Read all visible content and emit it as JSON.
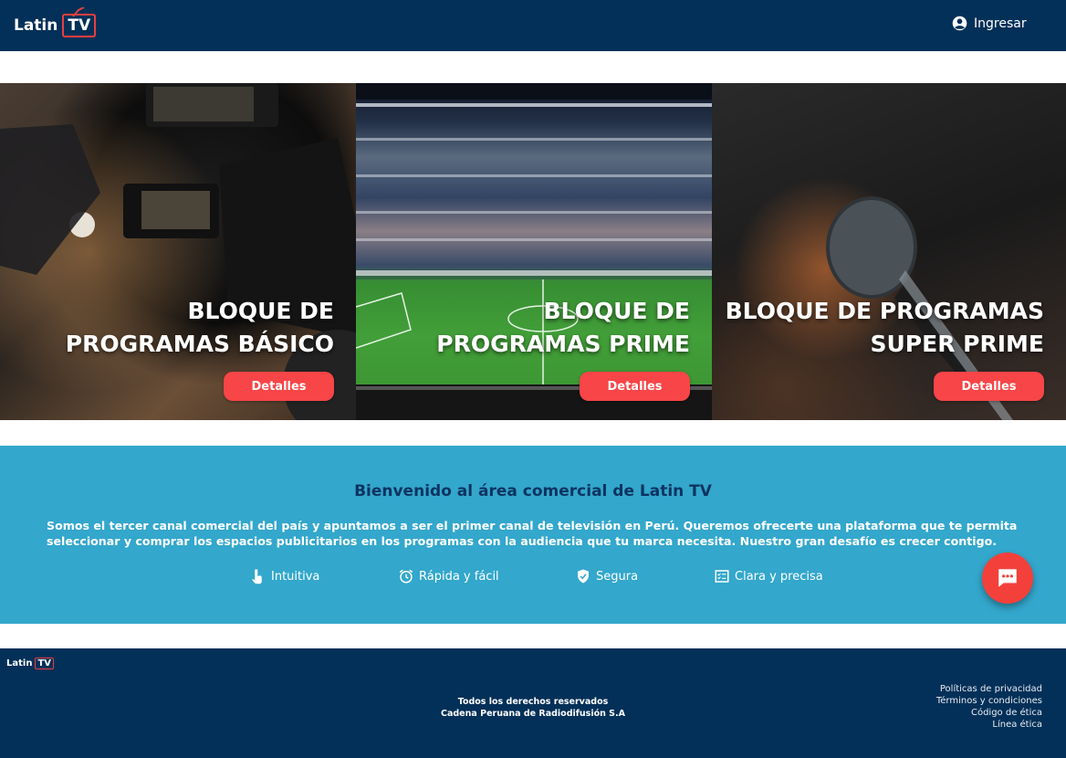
{
  "header": {
    "logo_text": "Latin",
    "logo_tv": "TV",
    "login_label": "Ingresar"
  },
  "blocks": [
    {
      "title_line1": "BLOQUE DE",
      "title_line2": "PROGRAMAS BÁSICO",
      "button_label": "Detalles"
    },
    {
      "title_line1": "BLOQUE DE",
      "title_line2": "PROGRAMAS PRIME",
      "button_label": "Detalles"
    },
    {
      "title_line1": "BLOQUE DE PROGRAMAS",
      "title_line2": "SUPER PRIME",
      "button_label": "Detalles"
    }
  ],
  "welcome": {
    "title": "Bienvenido al área comercial de Latin TV",
    "text": "Somos el tercer canal comercial del país y apuntamos a ser el primer canal de televisión en Perú. Queremos ofrecerte una plataforma que te permita seleccionar y comprar los espacios publicitarios en los programas con la audiencia que tu marca necesita.  Nuestro gran desafío es crecer contigo.",
    "features": [
      {
        "label": "Intuitiva",
        "icon": "touch-icon"
      },
      {
        "label": "Rápida y fácil",
        "icon": "alarm-clock-icon"
      },
      {
        "label": "Segura",
        "icon": "shield-check-icon"
      },
      {
        "label": "Clara y precisa",
        "icon": "checklist-icon"
      }
    ]
  },
  "chat": {
    "icon": "chat-bubble-icon"
  },
  "footer": {
    "logo_text": "Latin",
    "logo_tv": "TV",
    "rights": "Todos los derechos reservados",
    "company": "Cadena Peruana de Radiodifusión S.A",
    "links": [
      "Políticas de privacidad",
      "Términos y condiciones",
      "Código de ética",
      "Línea ética"
    ]
  },
  "colors": {
    "nav_bg": "#033058",
    "accent_red": "#f84547",
    "welcome_bg": "#33a7cc",
    "welcome_title": "#0d3461"
  }
}
